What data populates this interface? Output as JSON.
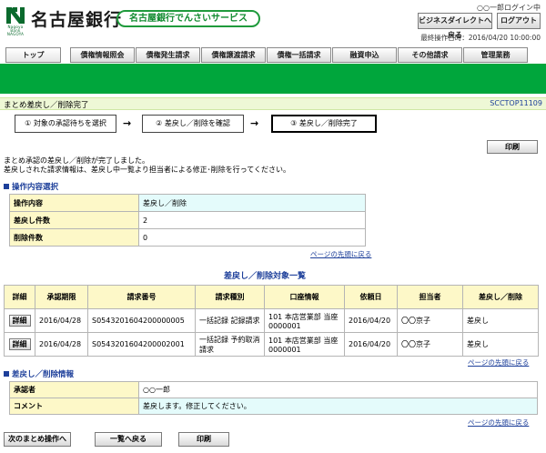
{
  "header": {
    "bank_name": "名古屋銀行",
    "service_name": "名古屋銀行でんさいサービス",
    "logo_text": "Nagoya Bank NAGOYA",
    "login_user": "○○一郎ログイン中",
    "business_direct_label": "ビジネスダイレクトへ戻る",
    "logout_label": "ログアウト",
    "last_operation": "最終操作日時：2016/04/20 10:00:00"
  },
  "tabs": [
    "トップ",
    "債権情報照会",
    "債権発生請求",
    "債権譲渡請求",
    "債権一括請求",
    "融資申込",
    "その他請求",
    "管理業務"
  ],
  "page": {
    "title": "まとめ差戻し／削除完了",
    "screen_id": "SCCTOP11109"
  },
  "steps": [
    "① 対象の承認待ちを選択",
    "② 差戻し／削除を確認",
    "③ 差戻し／削除完了"
  ],
  "arrow": "→",
  "print_label": "印刷",
  "messages": [
    "まとめ承認の差戻し／削除が完了しました。",
    "差戻しされた請求情報は、差戻し中一覧より担当者による修正･削除を行ってください。"
  ],
  "operation_section": {
    "heading": "操作内容選択",
    "rows": [
      {
        "label": "操作内容",
        "value": "差戻し／削除"
      },
      {
        "label": "差戻し件数",
        "value": "2"
      },
      {
        "label": "削除件数",
        "value": "0"
      }
    ]
  },
  "top_link": "ページの先頭に戻る",
  "list": {
    "title": "差戻し／削除対象一覧",
    "headers": [
      "詳細",
      "承認期限",
      "請求番号",
      "請求種別",
      "口座情報",
      "依頼日",
      "担当者",
      "差戻し／削除"
    ],
    "detail_label": "詳細",
    "rows": [
      {
        "deadline": "2016/04/28",
        "request_no": "S0543201604200000005",
        "type": "一括記録 記録請求",
        "account": "101 本店営業部 当座 0000001",
        "request_date": "2016/04/20",
        "person": "〇〇京子",
        "action": "差戻し"
      },
      {
        "deadline": "2016/04/28",
        "request_no": "S0543201604200002001",
        "type": "一括記録 予約取消請求",
        "account": "101 本店営業部 当座 0000001",
        "request_date": "2016/04/20",
        "person": "〇〇京子",
        "action": "差戻し"
      }
    ]
  },
  "remand_section": {
    "heading": "差戻し／削除情報",
    "rows": [
      {
        "label": "承認者",
        "value": "○○一郎"
      },
      {
        "label": "コメント",
        "value": "差戻します。修正してください。"
      }
    ]
  },
  "bottom_buttons": {
    "next_batch": "次のまとめ操作へ",
    "back_list": "一覧へ戻る",
    "print": "印刷"
  },
  "colors": {
    "green": "#00a63c",
    "link_blue": "#1d3f9a",
    "label_bg": "#fdf8c8",
    "value_bg": "#e4fbfb"
  }
}
